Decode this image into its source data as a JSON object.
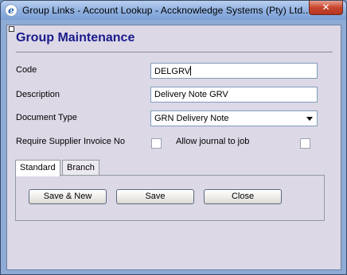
{
  "window": {
    "title": "Group Links - Account Lookup - Accknowledge Systems (Pty) Ltd...",
    "close_glyph": "✕",
    "app_icon_glyph": "e"
  },
  "form": {
    "header": "Group Maintenance",
    "code_label": "Code",
    "code_value": "DELGRV",
    "description_label": "Description",
    "description_value": "Delivery Note GRV",
    "document_type_label": "Document Type",
    "document_type_value": "GRN Delivery Note",
    "require_supplier_label": "Require Supplier Invoice No",
    "require_supplier_checked": false,
    "allow_journal_label": "Allow journal to job",
    "allow_journal_checked": false
  },
  "tabs": [
    {
      "label": "Standard",
      "active": true
    },
    {
      "label": "Branch",
      "active": false
    }
  ],
  "buttons": {
    "save_new": "Save & New",
    "save": "Save",
    "close": "Close"
  }
}
